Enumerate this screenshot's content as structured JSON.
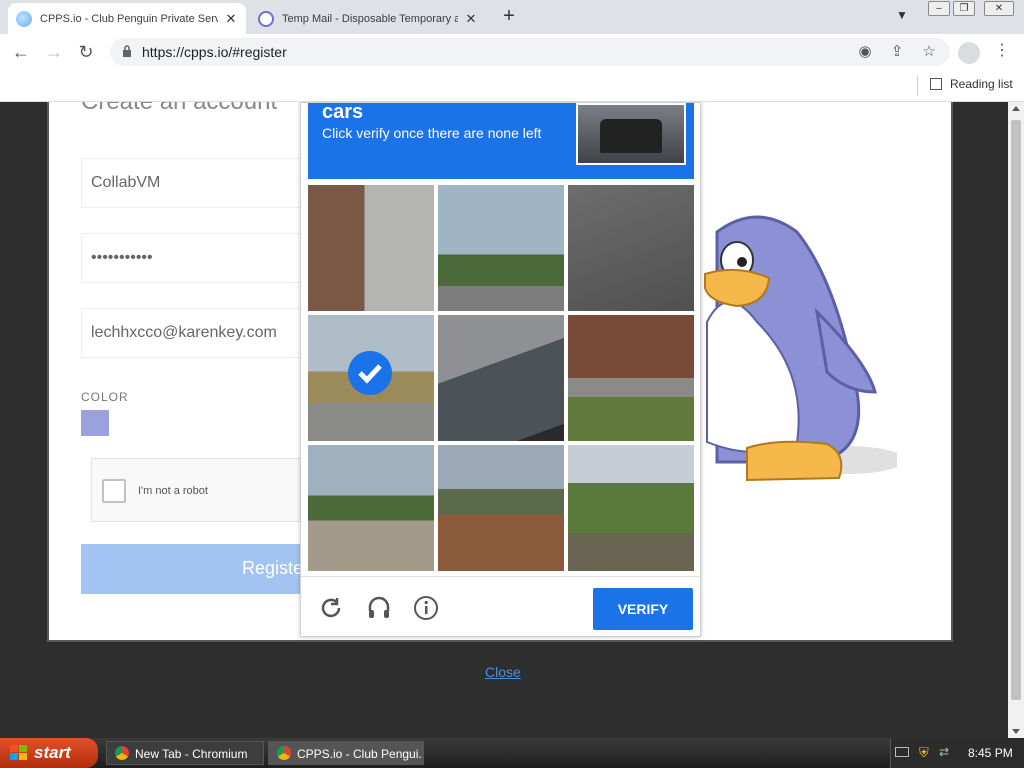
{
  "browser": {
    "tabs": [
      {
        "title": "CPPS.io - Club Penguin Private Serv",
        "active": true,
        "icon": "cpps-favicon"
      },
      {
        "title": "Temp Mail - Disposable Temporary a",
        "active": false,
        "icon": "tempmail-favicon"
      }
    ],
    "url": "https://cpps.io/#register",
    "reading_list": "Reading list"
  },
  "page": {
    "heading": "Create an account",
    "username_value": "CollabVM",
    "password_value": "•••••••••••",
    "email_value": "lechhxcco@karenkey.com",
    "color_label": "COLOR",
    "selected_color": "#9aa1dc",
    "recaptcha_label": "I'm not a robot",
    "register_label": "Register",
    "close_link": "Close"
  },
  "captcha": {
    "keyword": "cars",
    "instruction": "Click verify once there are none left",
    "verify_label": "VERIFY",
    "selected_tiles": [
      3
    ],
    "accent": "#1a73e8"
  },
  "taskbar": {
    "start_label": "start",
    "items": [
      "New Tab - Chromium",
      "CPPS.io - Club Pengui..."
    ],
    "clock": "8:45 PM"
  }
}
